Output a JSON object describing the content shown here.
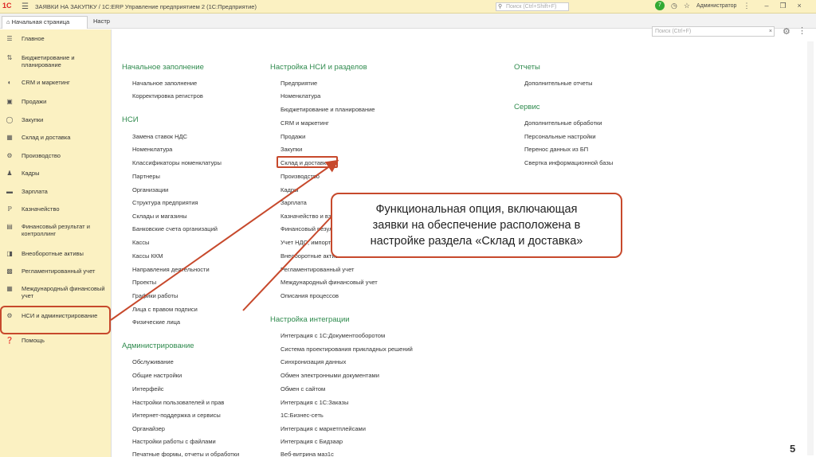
{
  "titlebar": {
    "logo": "1С",
    "title": "ЗАЯВКИ НА ЗАКУПКУ / 1С:ERP Управление предприятием 2 (1С:Предприятие)",
    "search_placeholder": "Поиск (Ctrl+Shift+F)",
    "user": "Администратор",
    "badge": "7"
  },
  "tabs": {
    "home": "Начальная страница",
    "other": "Настр"
  },
  "sidebar": {
    "items": [
      {
        "label": "Главное",
        "icon": "menu-icon"
      },
      {
        "label": "Бюджетирование и планирование",
        "icon": "chart-icon"
      },
      {
        "label": "CRM и маркетинг",
        "icon": "crm-icon"
      },
      {
        "label": "Продажи",
        "icon": "bag-icon"
      },
      {
        "label": "Закупки",
        "icon": "cart-icon"
      },
      {
        "label": "Склад и доставка",
        "icon": "warehouse-icon"
      },
      {
        "label": "Производство",
        "icon": "factory-icon"
      },
      {
        "label": "Кадры",
        "icon": "person-icon"
      },
      {
        "label": "Зарплата",
        "icon": "salary-icon"
      },
      {
        "label": "Казначейство",
        "icon": "treasury-icon"
      },
      {
        "label": "Финансовый результат и контроллинг",
        "icon": "finance-icon"
      },
      {
        "label": "Внеоборотные активы",
        "icon": "assets-icon"
      },
      {
        "label": "Регламентированный учет",
        "icon": "accounting-icon"
      },
      {
        "label": "Международный финансовый учет",
        "icon": "international-icon"
      },
      {
        "label": "НСИ и администрирование",
        "icon": "gear-icon"
      },
      {
        "label": "Помощь",
        "icon": "help-icon"
      }
    ]
  },
  "main": {
    "search_placeholder": "Поиск (Ctrl+F)",
    "col1": {
      "sec1_title": "Начальное заполнение",
      "sec1_links": [
        "Начальное заполнение",
        "Корректировка регистров"
      ],
      "sec2_title": "НСИ",
      "sec2_links": [
        "Замена ставок НДС",
        "Номенклатура",
        "Классификаторы номенклатуры",
        "Партнеры",
        "Организации",
        "Структура предприятия",
        "Склады и магазины",
        "Банковские счета организаций",
        "Кассы",
        "Кассы ККМ",
        "Направления деятельности",
        "Проекты",
        "Графики работы",
        "Лица с правом подписи",
        "Физические лица"
      ],
      "sec3_title": "Администрирование",
      "sec3_links": [
        "Обслуживание",
        "Общие настройки",
        "Интерфейс",
        "Настройки пользователей и прав",
        "Интернет-поддержка и сервисы",
        "Органайзер",
        "Настройки работы с файлами",
        "Печатные формы, отчеты и обработки"
      ]
    },
    "col2": {
      "sec1_title": "Настройка НСИ и разделов",
      "sec1_links": [
        "Предприятие",
        "Номенклатура",
        "Бюджетирование и планирование",
        "CRM и маркетинг",
        "Продажи",
        "Закупки",
        "Склад и доставка",
        "Производство",
        "Кадры",
        "Зарплата",
        "Казначейство и взаиморасчеты",
        "Финансовый результат и контроллинг",
        "Учет НДС, импорт и экспорт",
        "Внеоборотные активы",
        "Регламентированный учет",
        "Международный финансовый учет",
        "Описания процессов"
      ],
      "sec2_title": "Настройка интеграции",
      "sec2_links": [
        "Интеграция с 1С:Документооборотом",
        "Система проектирования прикладных решений",
        "Синхронизация данных",
        "Обмен электронными документами",
        "Обмен с сайтом",
        "Интеграция с 1С:Заказы",
        "1С:Бизнес-сеть",
        "Интеграция с маркетплейсами",
        "Интеграция с Бидзаар",
        "Веб-витрина маз1с"
      ]
    },
    "col3": {
      "sec1_title": "Отчеты",
      "sec1_links": [
        "Дополнительные отчеты"
      ],
      "sec2_title": "Сервис",
      "sec2_links": [
        "Дополнительные обработки",
        "Персональные настройки",
        "Перенос данных из БП",
        "Свертка информационной базы"
      ]
    }
  },
  "callout": {
    "lines": [
      "Функциональная опция, включающая",
      "заявки на обеспечение расположена в",
      "настройке раздела «Склад и доставка»"
    ]
  },
  "page_number": "5",
  "colors": {
    "section_title": "#2e8a4d",
    "highlight": "#c7492c",
    "sidebar_bg": "#fbf1c2"
  }
}
